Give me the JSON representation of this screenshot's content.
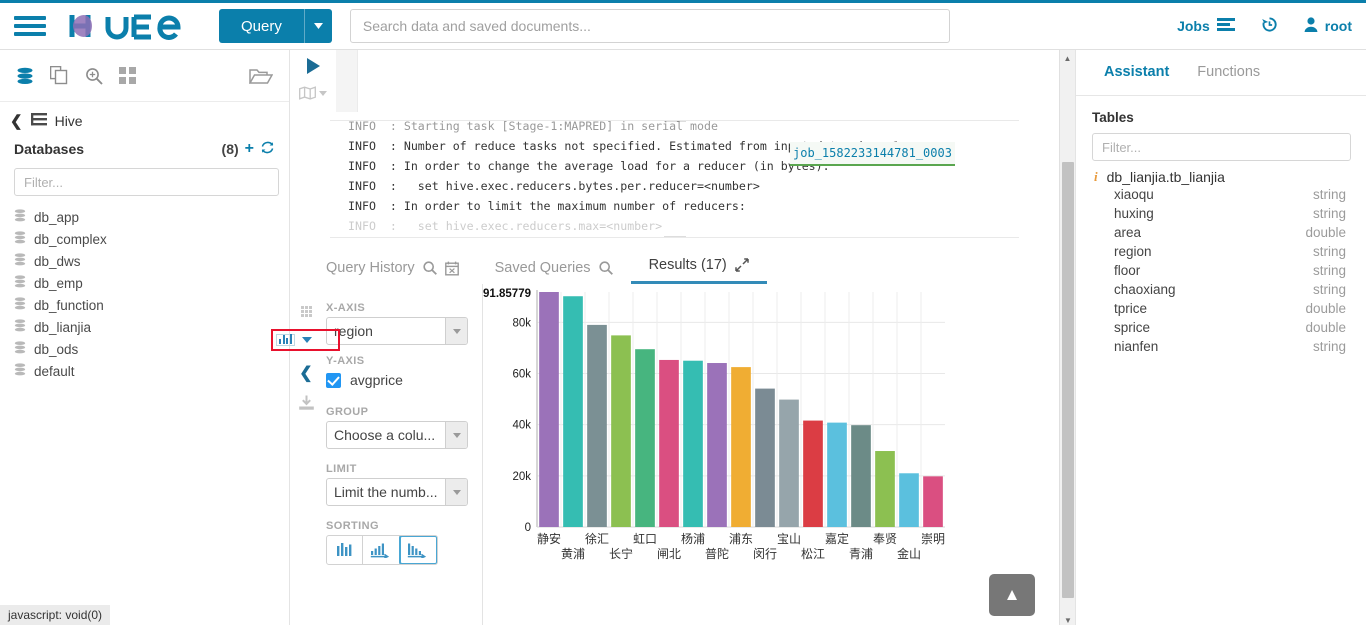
{
  "topnav": {
    "brand": "hue",
    "query_label": "Query",
    "search_placeholder": "Search data and saved documents...",
    "jobs_label": "Jobs",
    "user_label": "root",
    "history_icon": "history-icon",
    "jobs_icon": "jobs-list-icon",
    "user_icon": "user-icon",
    "accent": "#0b7fab"
  },
  "left_panel": {
    "icons": [
      "database-icon",
      "documents-icon",
      "search-zoom-icon",
      "apps-grid-icon",
      "open-folder-icon"
    ],
    "source_label": "Hive",
    "databases_label": "Databases",
    "databases_count": "(8)",
    "filter_placeholder": "Filter...",
    "databases": [
      {
        "name": "db_app"
      },
      {
        "name": "db_complex"
      },
      {
        "name": "db_dws"
      },
      {
        "name": "db_emp"
      },
      {
        "name": "db_function"
      },
      {
        "name": "db_lianjia"
      },
      {
        "name": "db_ods"
      },
      {
        "name": "default"
      }
    ]
  },
  "editor": {
    "log_lines": [
      "INFO  : Starting task [Stage-1:MAPRED] in serial mode",
      "INFO  : Number of reduce tasks not specified. Estimated from input data size: 1",
      "INFO  : In order to change the average load for a reducer (in bytes):",
      "INFO  :   set hive.exec.reducers.bytes.per.reducer=<number>",
      "INFO  : In order to limit the maximum number of reducers:",
      "INFO  :   set hive.exec.reducers.max=<number>"
    ],
    "job_link": "job_1582233144781_0003"
  },
  "tabs": [
    {
      "label": "Query History",
      "icons": [
        "search-icon",
        "calendar-clear-icon"
      ],
      "active": false
    },
    {
      "label": "Saved Queries",
      "icons": [
        "search-icon"
      ],
      "active": false
    },
    {
      "label": "Results (17)",
      "icons": [
        "expand-icon"
      ],
      "active": true
    }
  ],
  "chart_controls": {
    "x_axis_label": "X-AXIS",
    "x_axis_value": "region",
    "y_axis_label": "Y-AXIS",
    "y_axis_value": "avgprice",
    "y_axis_checked": true,
    "group_label": "GROUP",
    "group_value": "Choose a colu...",
    "limit_label": "LIMIT",
    "limit_value": "Limit the numb...",
    "sorting_label": "SORTING",
    "sorting_options": [
      "sort-none-icon",
      "sort-ascending-icon",
      "sort-descending-icon"
    ],
    "sorting_selected_index": 2,
    "chart_type_icon": "bar-chart-icon",
    "highlight_color": "#e8112d"
  },
  "chart_data": {
    "type": "bar",
    "title": "",
    "xlabel": "region",
    "ylabel": "avgprice",
    "ylim": [
      0,
      91.85779
    ],
    "y_top_label": "91.85779",
    "ytick_labels": [
      "0",
      "20k",
      "40k",
      "60k",
      "80k"
    ],
    "ytick_values": [
      0,
      20000,
      40000,
      60000,
      80000
    ],
    "ymax_value": 91857.79,
    "grid": true,
    "legend": "none",
    "categories": [
      "静安",
      "黄浦",
      "徐汇",
      "长宁",
      "虹口",
      "闸北",
      "杨浦",
      "普陀",
      "浦东",
      "闵行",
      "宝山",
      "松江",
      "嘉定",
      "青浦",
      "奉贤",
      "金山",
      "崇明"
    ],
    "values": [
      91857.79,
      90200,
      79000,
      74900,
      69500,
      65300,
      65000,
      64100,
      62500,
      54100,
      49800,
      41600,
      40800,
      39800,
      29700,
      21000,
      19800
    ],
    "colors": [
      "#9b72b9",
      "#35bdb2",
      "#7b9094",
      "#8cc051",
      "#47b57f",
      "#da4f81",
      "#35bdb2",
      "#9b72b9",
      "#f0ad33",
      "#7b8b94",
      "#96a5ab",
      "#db3d44",
      "#5bc0de",
      "#6c8b87",
      "#8cc051",
      "#5bc0de",
      "#da4f81"
    ]
  },
  "right_panel": {
    "tabs": [
      {
        "label": "Assistant",
        "active": true
      },
      {
        "label": "Functions",
        "active": false
      }
    ],
    "section_title": "Tables",
    "filter_placeholder": "Filter...",
    "table_name": "db_lianjia.tb_lianjia",
    "columns": [
      {
        "name": "xiaoqu",
        "type": "string"
      },
      {
        "name": "huxing",
        "type": "string"
      },
      {
        "name": "area",
        "type": "double"
      },
      {
        "name": "region",
        "type": "string"
      },
      {
        "name": "floor",
        "type": "string"
      },
      {
        "name": "chaoxiang",
        "type": "string"
      },
      {
        "name": "tprice",
        "type": "double"
      },
      {
        "name": "sprice",
        "type": "double"
      },
      {
        "name": "nianfen",
        "type": "string"
      }
    ]
  },
  "status_bar": {
    "text": "javascript: void(0)"
  },
  "back_to_top": {
    "icon": "chevron-up-icon"
  }
}
